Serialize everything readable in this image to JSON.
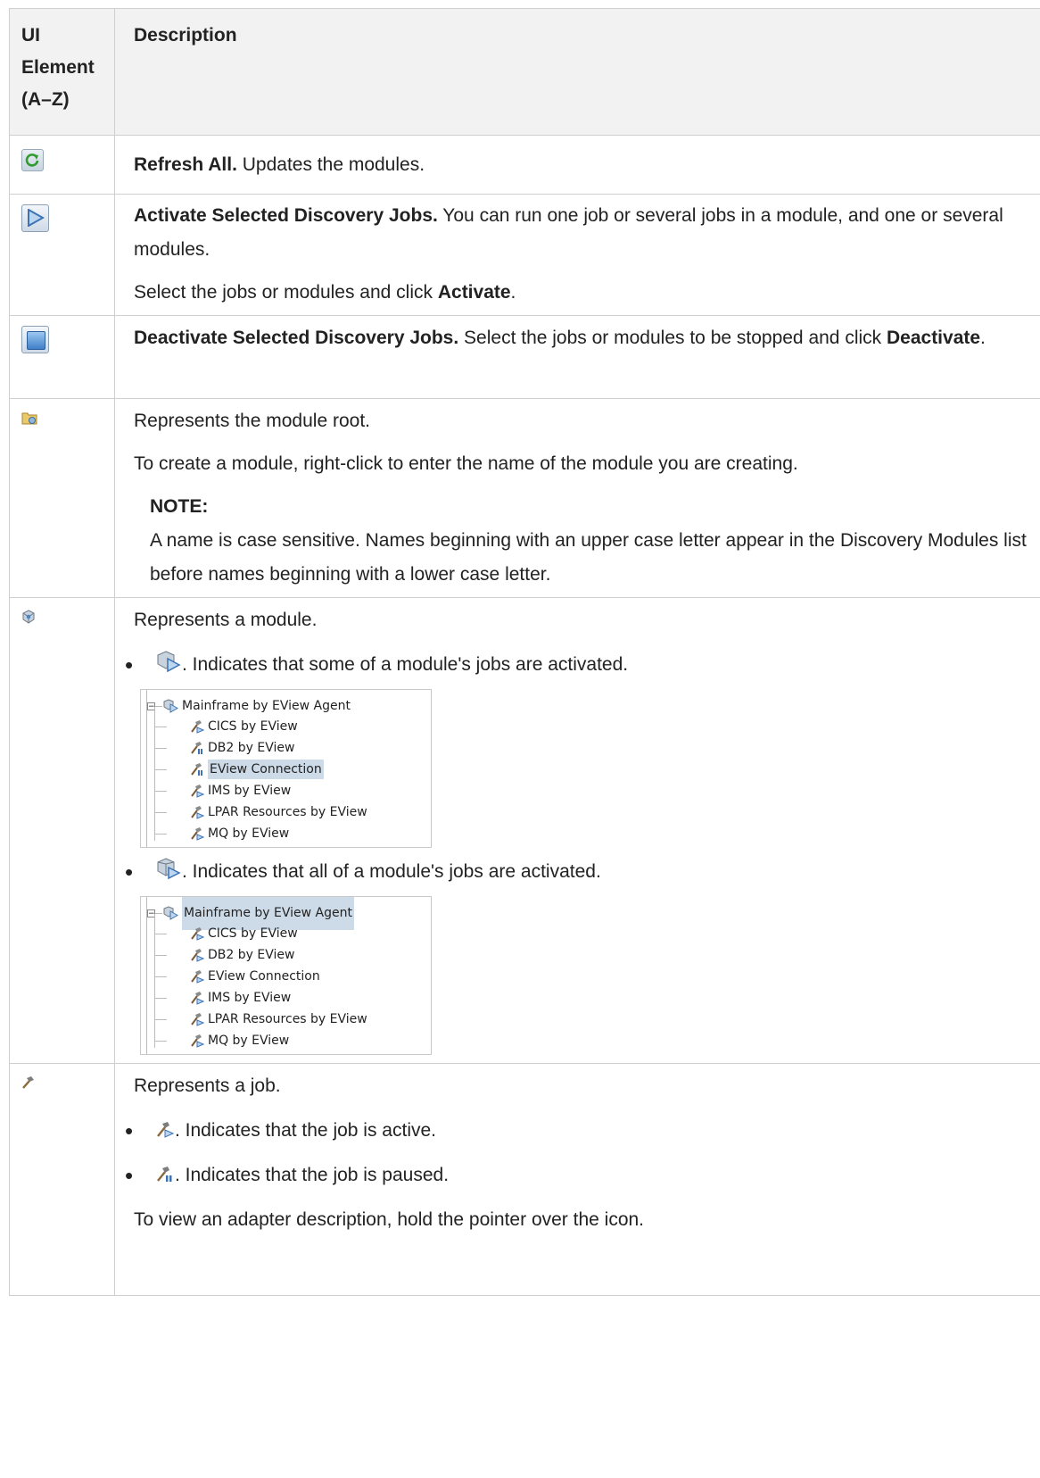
{
  "header": {
    "col1": "UI Element (A–Z)",
    "col2": "Description"
  },
  "rows": {
    "refresh": {
      "icon": "refresh-icon",
      "bold": "Refresh All.",
      "text": " Updates the modules."
    },
    "activate": {
      "icon": "activate-play-icon",
      "bold": "Activate Selected Discovery Jobs.",
      "text": " You can run one job or several jobs in a module, and one or several modules.",
      "p2_pre": "Select the jobs or modules and click ",
      "p2_bold": "Activate",
      "p2_post": "."
    },
    "deactivate": {
      "icon": "deactivate-stop-icon",
      "bold": "Deactivate Selected Discovery Jobs.",
      "text": " Select the jobs or modules to be stopped and click ",
      "bold2": "Deactivate",
      "post": "."
    },
    "root": {
      "icon": "module-root-folder-icon",
      "p1": "Represents the module root.",
      "p2": "To create a module, right-click to enter the name of the module you are creating.",
      "note_label": "NOTE:",
      "note_text": "A name is case sensitive. Names beginning with an upper case letter appear in the Discovery Modules list before names beginning with a lower case letter."
    },
    "module": {
      "icon": "module-cube-icon",
      "p1": "Represents a module.",
      "b1": ". Indicates that some of a module's jobs are activated.",
      "b2": ". Indicates that all of a module's jobs are activated.",
      "tree1": {
        "root": "Mainframe by EView Agent",
        "items": [
          "CICS by EView",
          "DB2 by EView",
          "EView Connection",
          "IMS by EView",
          "LPAR Resources by EView",
          "MQ by EView"
        ]
      },
      "tree2": {
        "root": "Mainframe by EView Agent",
        "items": [
          "CICS by EView",
          "DB2 by EView",
          "EView Connection",
          "IMS by EView",
          "LPAR Resources by EView",
          "MQ by EView"
        ]
      }
    },
    "job": {
      "icon": "job-hammer-icon",
      "p1": "Represents a job.",
      "b1": ". Indicates that the job is active.",
      "b2": ". Indicates that the job is paused.",
      "p2": "To view an adapter description, hold the pointer over the icon."
    }
  }
}
